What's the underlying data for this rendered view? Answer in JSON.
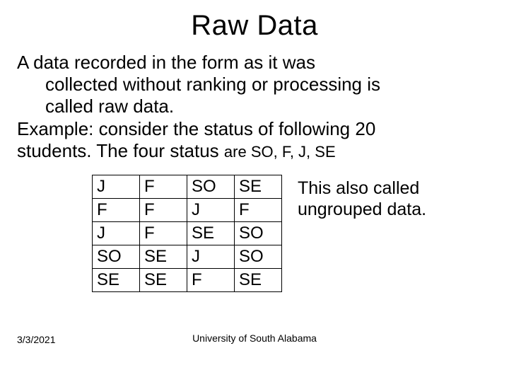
{
  "title": "Raw Data",
  "para1_line1": "A data recorded in the form as it was",
  "para1_line2": "collected without ranking or processing is",
  "para1_line3": "called raw data.",
  "para2_line1": "Example: consider the status of following 20",
  "para2_line2a": "students. The four status ",
  "para2_line2b": "are SO, F, J, SE",
  "table": {
    "rows": [
      [
        "J",
        "F",
        "SO",
        "SE"
      ],
      [
        "F",
        "F",
        "J",
        "F"
      ],
      [
        "J",
        "F",
        "SE",
        "SO"
      ],
      [
        "SO",
        "SE",
        "J",
        "SO"
      ],
      [
        "SE",
        "SE",
        "F",
        "SE"
      ]
    ]
  },
  "side_note_line1": "This also called",
  "side_note_line2": "ungrouped data.",
  "footer_date": "3/3/2021",
  "footer_center": "University of South Alabama"
}
